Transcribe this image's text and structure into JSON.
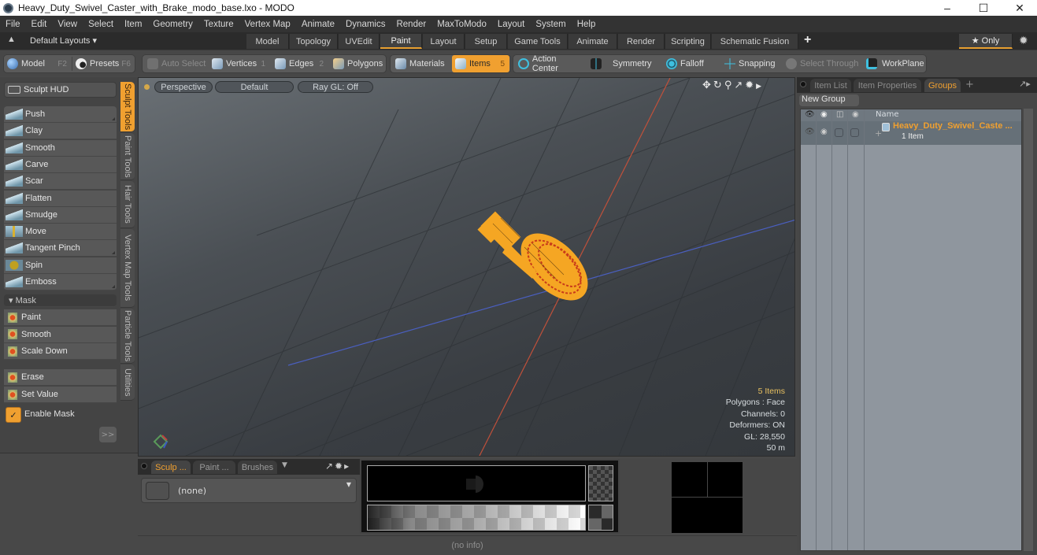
{
  "window": {
    "title": "Heavy_Duty_Swivel_Caster_with_Brake_modo_base.lxo - MODO",
    "controls": {
      "minimize": "–",
      "maximize": "☐",
      "close": "✕"
    }
  },
  "menu": [
    "File",
    "Edit",
    "View",
    "Select",
    "Item",
    "Geometry",
    "Texture",
    "Vertex Map",
    "Animate",
    "Dynamics",
    "Render",
    "MaxToModo",
    "Layout",
    "System",
    "Help"
  ],
  "layout_bar": {
    "layouts_label": "Default Layouts ▾",
    "tabs": [
      "Model",
      "Topology",
      "UVEdit",
      "Paint",
      "Layout",
      "Setup",
      "Game Tools",
      "Animate",
      "Render",
      "Scripting",
      "Schematic Fusion"
    ],
    "active_tab": "Paint",
    "add_label": "+",
    "only_label": "★ Only"
  },
  "toolbar": {
    "model": {
      "label": "Model",
      "key": "F2"
    },
    "presets": {
      "label": "Presets",
      "key": "F6"
    },
    "auto_select": "Auto Select",
    "vertices": {
      "label": "Vertices",
      "key": "1"
    },
    "edges": {
      "label": "Edges",
      "key": "2"
    },
    "polygons": "Polygons",
    "materials": "Materials",
    "items": {
      "label": "Items",
      "key": "5"
    },
    "action_center": "Action Center",
    "symmetry": "Symmetry",
    "falloff": "Falloff",
    "snapping": "Snapping",
    "select_through": "Select Through",
    "workplane": "WorkPlane"
  },
  "left_panel": {
    "sculpt_hud": "Sculpt HUD",
    "tools": [
      "Push",
      "Clay",
      "Smooth",
      "Carve",
      "Scar",
      "Flatten",
      "Smudge",
      "Move",
      "Tangent Pinch",
      "Spin",
      "Emboss"
    ],
    "mask_header": "▾ Mask",
    "mask_tools": [
      "Paint",
      "Smooth",
      "Scale Down"
    ],
    "mask_tools2": [
      "Erase",
      "Set Value"
    ],
    "enable_mask": {
      "label": "Enable Mask",
      "checked": true
    },
    "expand_label": ">>",
    "vertical_tabs": [
      "Sculpt Tools",
      "Paint Tools",
      "Hair Tools",
      "Vertex Map Tools",
      "Particle Tools",
      "Utilities"
    ],
    "active_vertical_tab": "Sculpt Tools"
  },
  "viewport": {
    "view_mode": "Perspective",
    "shading": "Default",
    "raygl": "Ray GL: Off",
    "stats": {
      "items": "5 Items",
      "polygons": "Polygons : Face",
      "channels": "Channels: 0",
      "deformers": "Deformers: ON",
      "gl": "GL: 28,550",
      "scale": "50 m"
    }
  },
  "brush_panel": {
    "tabs": [
      "Sculp ...",
      "Paint ...",
      "Brushes"
    ],
    "active_tab": "Sculp ...",
    "preset_value": "(none)"
  },
  "info_bar": "(no info)",
  "right_panel": {
    "tabs": [
      "Item List",
      "Item Properties",
      "Groups"
    ],
    "active_tab": "Groups",
    "add_label": "+",
    "new_group": "New Group",
    "column_name": "Name",
    "groups": [
      {
        "name": "Heavy_Duty_Swivel_Caste ...",
        "count": "1 Item"
      }
    ]
  },
  "colors": {
    "accent": "#f0a030",
    "x_axis": "#c0503a",
    "z_axis": "#4a5fc0",
    "mesh": "#f5a623"
  }
}
